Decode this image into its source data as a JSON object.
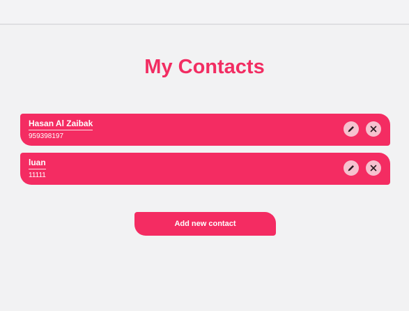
{
  "page": {
    "title": "My Contacts"
  },
  "contacts": [
    {
      "name": "Hasan Al Zaibak",
      "phone": "959398197"
    },
    {
      "name": "luan",
      "phone": "11111"
    }
  ],
  "actions": {
    "edit_icon": "pencil-icon",
    "delete_icon": "close-icon",
    "add_label": "Add new contact"
  },
  "colors": {
    "accent": "#f42c62",
    "icon_button_bg": "#f6c1cf",
    "background": "#f2f2f3"
  }
}
